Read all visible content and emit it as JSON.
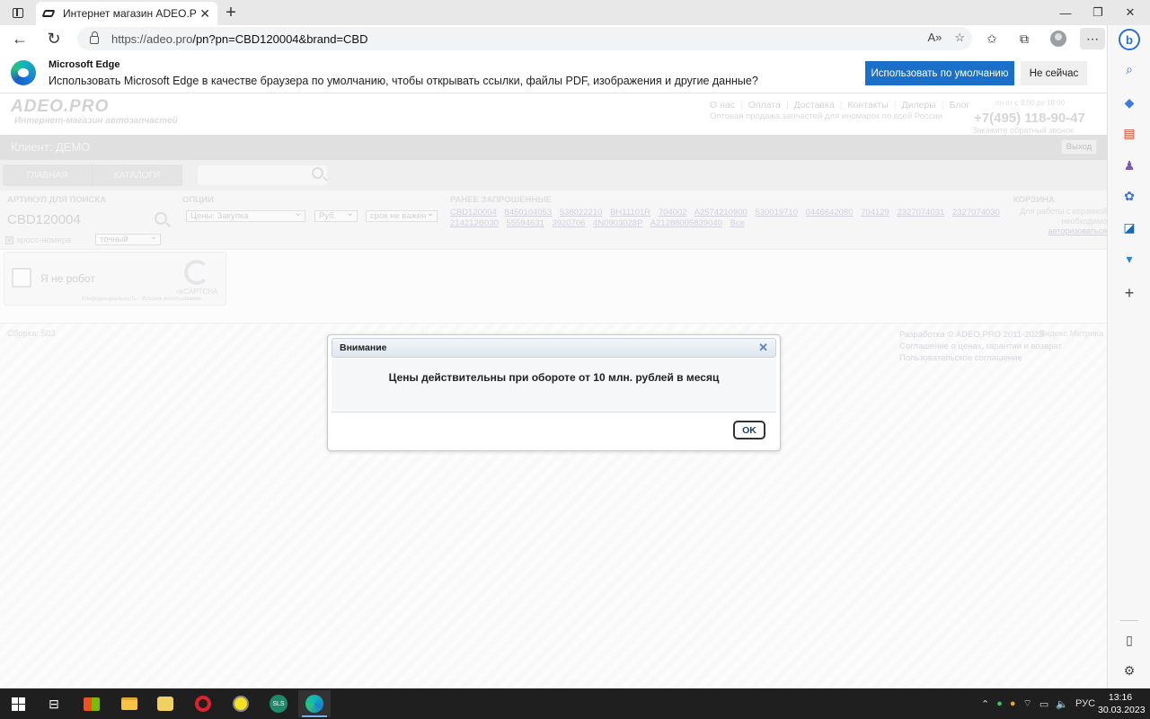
{
  "browser": {
    "tab_title": "Интернет магазин ADEO.PRO О",
    "url_host": "https://adeo.pro",
    "url_path": "/pn?pn=CBD120004&brand=CBD",
    "tab_close": "✕",
    "new_tab": "+",
    "win_min": "—",
    "win_max": "❐",
    "win_close": "✕"
  },
  "edge_prompt": {
    "title": "Microsoft Edge",
    "message": "Использовать Microsoft Edge в качестве браузера по умолчанию, чтобы открывать ссылки, файлы PDF, изображения и другие данные?",
    "primary_label": "Использовать по умолчанию",
    "secondary_label": "Не сейчас"
  },
  "site": {
    "logo": "ADEO.PRO",
    "logo_sub": "Интернет-магазин автозапчастей",
    "menu": [
      "О нас",
      "Оплата",
      "Доставка",
      "Контакты",
      "Дилеры",
      "Блог"
    ],
    "menu_sep": "|",
    "tagline": "Оптовая продажа запчастей для иномарок по всей России",
    "worktime": "пн-пт с 9:00 до 18:00",
    "phone": "+7(495) 118-90-47",
    "callback": "Закажите обратный звонок",
    "client_label": "Клиент: ДЕМО",
    "logout": "Выход",
    "nav_tabs": [
      "ГЛАВНАЯ",
      "КАТАЛОГИ"
    ]
  },
  "search": {
    "article_header": "АРТИКУЛ ДЛЯ ПОИСКА",
    "article_value": "CBD120004",
    "options_header": "ОПЦИИ",
    "price_select": "Цены: Закупка",
    "currency_select": "Руб.",
    "term_select": "срок не важен",
    "cross_label": "кросс-номера",
    "match_select": "точный",
    "recent_header": "РАНЕЕ ЗАПРОШЕННЫЕ",
    "recent": [
      "CBD120004",
      "8450104053",
      "538022210",
      "BH11101R",
      "704002",
      "A2574210900",
      "530019710",
      "0446642080",
      "704129",
      "2327074031",
      "2327074030",
      "214212B030",
      "55594631",
      "3920706",
      "4N0903028P",
      "A21288005839040",
      "Все"
    ],
    "cart_header": "КОРЗИНА",
    "cart_text": "Для работы с корзиной необходимо",
    "cart_link": "авторизоваться"
  },
  "captcha": {
    "label": "Я не робот",
    "brand": "reCAPTCHA",
    "terms": "Конфиденциальность - Условия использования"
  },
  "footer": {
    "build": "Сборка: 503",
    "copyright": "Разработка © ADEO.PRO 2011-2023",
    "agreement1": "Соглашение о ценах, гарантии и возврат",
    "agreement2": "Пользовательское соглашение",
    "metrika": "Яндекс.Метрика"
  },
  "dialog": {
    "title": "Внимание",
    "close": "✕",
    "message": "Цены действительны при обороте от 10 млн. рублей в месяц",
    "ok_label": "OK"
  },
  "taskbar": {
    "lang": "РУС",
    "time": "13:16",
    "date": "30.03.2023"
  },
  "colors": {
    "edge_blue": "#1a6fc9",
    "taskbar": "#1f1f1f",
    "dialog_title_bg": "#dfe6ee"
  }
}
